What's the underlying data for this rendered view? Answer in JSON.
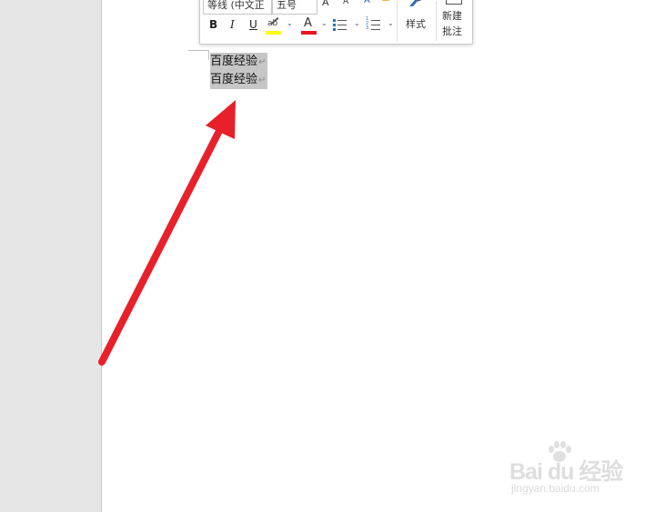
{
  "toolbar": {
    "font_name": "等线 (中文正",
    "font_size": "五号",
    "grow_font": "A",
    "shrink_font": "A",
    "bold": "B",
    "italic": "I",
    "underline": "U",
    "highlight_label": "ab",
    "font_color_label": "A",
    "styles_label": "样式",
    "new_comment_line1": "新建",
    "new_comment_line2": "批注",
    "highlight_color": "#ffff00",
    "font_color": "#e8161a",
    "icons": [
      "grow-font-icon",
      "shrink-font-icon",
      "clear-format-icon",
      "format-painter-icon",
      "highlight-icon",
      "font-color-icon",
      "bullets-icon",
      "numbering-icon",
      "styles-icon",
      "comment-icon"
    ]
  },
  "document": {
    "lines": [
      {
        "text": "百度经验",
        "mark": "↵"
      },
      {
        "text": "百度经验",
        "mark": "↵"
      }
    ],
    "selection_color": "#c6c6c6"
  },
  "annotation": {
    "arrow_color": "#e8202a"
  },
  "watermark": {
    "logo_text": "Bai  du 经验",
    "url": "jingyan.baidu.com"
  }
}
